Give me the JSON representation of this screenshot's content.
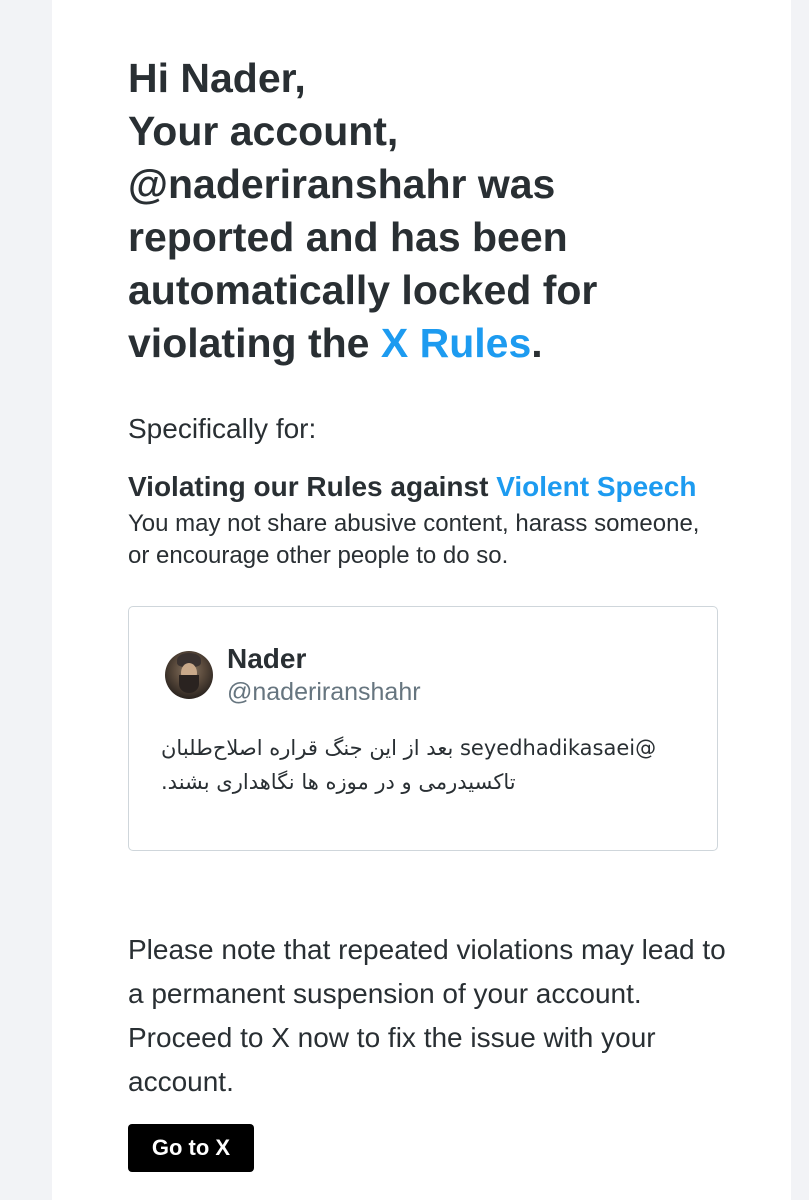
{
  "email": {
    "headline": {
      "line1": "Hi Nader,",
      "line2": "Your account,",
      "line3": "@naderiranshahr was",
      "line4": "reported and has been",
      "line5": "automatically locked for",
      "line6_prefix": "violating the ",
      "rules_link": "X Rules",
      "line6_suffix": "."
    },
    "specifically_label": "Specifically for:",
    "rule": {
      "prefix": "Violating our Rules against ",
      "link": "Violent Speech",
      "description": "You may not share abusive content, harass someone, or encourage other people to do so."
    },
    "tweet": {
      "name": "Nader",
      "handle": "@naderiranshahr",
      "text": "@seyedhadikasaei بعد از این جنگ قراره اصلاح‌طلبان تاکسیدرمی و در موزه ها نگاهداری بشند."
    },
    "notice": "Please note that repeated violations may lead to a permanent suspension of your account. Proceed to X now to fix the issue with your account.",
    "cta_label": "Go to X"
  },
  "colors": {
    "link": "#1d9bf0",
    "text": "#292f33",
    "muted": "#66757f",
    "button_bg": "#000000",
    "side_strip": "#f2f3f6"
  }
}
